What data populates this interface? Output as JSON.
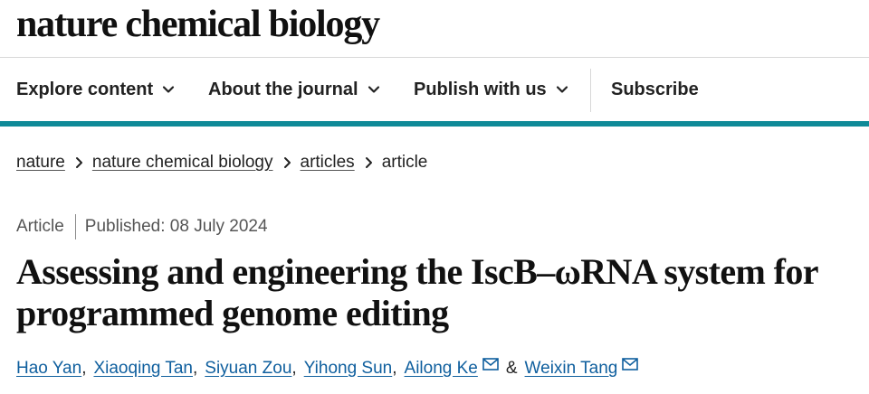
{
  "header": {
    "brand": "nature chemical biology"
  },
  "nav": {
    "items": [
      {
        "label": "Explore content",
        "has_dropdown": true
      },
      {
        "label": "About the journal",
        "has_dropdown": true
      },
      {
        "label": "Publish with us",
        "has_dropdown": true
      }
    ],
    "subscribe_label": "Subscribe",
    "accent_color": "#0f8a98"
  },
  "breadcrumb": {
    "items": [
      "nature",
      "nature chemical biology",
      "articles"
    ],
    "current": "article"
  },
  "article": {
    "type": "Article",
    "published": "Published: 08 July 2024",
    "title": "Assessing and engineering the IscB–ωRNA system for programmed genome editing",
    "authors": [
      {
        "name": "Hao Yan",
        "email_icon": false
      },
      {
        "name": "Xiaoqing Tan",
        "email_icon": false
      },
      {
        "name": "Siyuan Zou",
        "email_icon": false
      },
      {
        "name": "Yihong Sun",
        "email_icon": false
      },
      {
        "name": "Ailong Ke",
        "email_icon": true
      },
      {
        "name": "Weixin Tang",
        "email_icon": true
      }
    ],
    "author_separator": "&",
    "link_color": "#0f5f9e"
  }
}
